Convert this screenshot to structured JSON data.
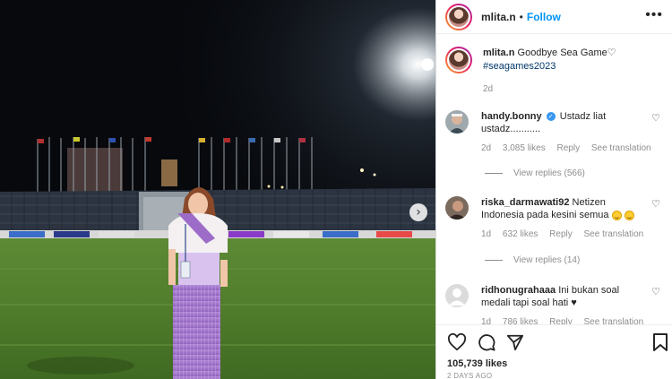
{
  "post": {
    "username": "mlita.n",
    "follow_label": "Follow",
    "more_label": "•••",
    "caption_text": "Goodbye Sea Game♡",
    "caption_hashtag": "#seagames2023",
    "caption_time": "2d",
    "likes": "105,739 likes",
    "posted_ago": "2 DAYS AGO",
    "next_label": "›"
  },
  "comments": [
    {
      "username": "handy.bonny",
      "verified": true,
      "text": "Ustadz liat ustadz...........",
      "time": "2d",
      "likes": "3,085 likes",
      "reply_label": "Reply",
      "translation_label": "See translation",
      "view_replies": "View replies (566)"
    },
    {
      "username": "riska_darmawati92",
      "verified": false,
      "text": "Netizen Indonesia pada kesini semua",
      "time": "1d",
      "likes": "632 likes",
      "reply_label": "Reply",
      "translation_label": "See translation",
      "view_replies": "View replies (14)"
    },
    {
      "username": "ridhonugrahaaa",
      "verified": false,
      "text": "Ini bukan soal medali tapi soal hati ♥",
      "time": "1d",
      "likes": "786 likes",
      "reply_label": "Reply",
      "translation_label": "See translation"
    }
  ],
  "icons": {
    "like": "heart-icon",
    "comment": "comment-icon",
    "share": "share-icon",
    "save": "bookmark-icon",
    "comment_like": "heart-icon",
    "next": "chevron-right-icon",
    "emoji": "laughing-emoji-icon"
  },
  "colors": {
    "link": "#0095f6",
    "hashtag": "#00376b",
    "muted": "#8e8e8e",
    "text": "#262626"
  }
}
